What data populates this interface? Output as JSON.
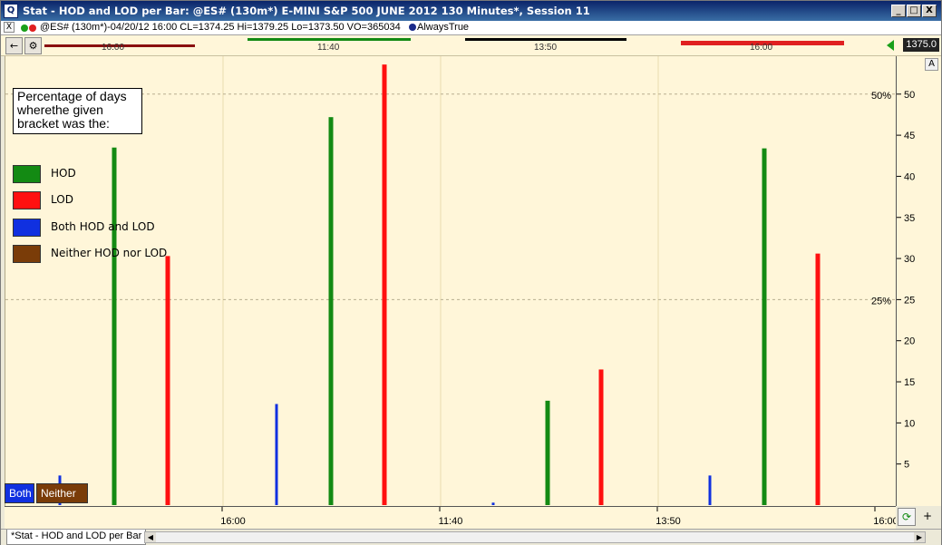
{
  "window": {
    "title": "Stat - HOD and LOD per Bar: @ES# (130m*) E-MINI S&P 500 JUNE 2012 130 Minutes*, Session 11",
    "minimize": "_",
    "maximize": "□",
    "close": "X"
  },
  "status": {
    "close_x": "X",
    "info": "@ES# (130m*)-04/20/12 16:00 CL=1374.25 Hi=1379.25 Lo=1373.50 VO=365034",
    "indicator": "AlwaysTrue",
    "indicator_color": "#1a2a8a",
    "dot_colors": [
      "#1aa01a",
      "#e02020"
    ]
  },
  "toprow": {
    "ticks": [
      "16:00",
      "11:40",
      "13:50",
      "16:00"
    ],
    "price": "1375.0",
    "price_top": "1375"
  },
  "legend": {
    "note": "Percentage of days wherethe given bracket was the:",
    "items": [
      {
        "label": "HOD",
        "color": "#138a13"
      },
      {
        "label": "LOD",
        "color": "#ff1010"
      },
      {
        "label": "Both HOD and LOD",
        "color": "#1030e0"
      },
      {
        "label": "Neither HOD nor LOD",
        "color": "#7a3c08"
      }
    ]
  },
  "buttons": {
    "both": "Both",
    "neither": "Neither",
    "axis_auto": "A",
    "refresh": "⟳",
    "add": "+"
  },
  "chart_data": {
    "type": "bar",
    "x_ticks": [
      "16:00",
      "11:40",
      "13:50",
      "16:00"
    ],
    "y_ticks": [
      5,
      10,
      15,
      20,
      25,
      30,
      35,
      40,
      45,
      50
    ],
    "ylim": [
      0,
      54.5
    ],
    "reference_lines": [
      {
        "value": 50,
        "label": "50%"
      },
      {
        "value": 25,
        "label": "25%"
      }
    ],
    "groups": [
      {
        "both": 3.6,
        "hod": 43.5,
        "lod": 30.3
      },
      {
        "both": 12.3,
        "hod": 47.2,
        "lod": 53.6
      },
      {
        "both": 0.3,
        "hod": 12.7,
        "lod": 16.5
      },
      {
        "both": 3.6,
        "hod": 43.4,
        "lod": 30.6
      }
    ]
  },
  "tabs": {
    "active": "*Stat - HOD and LOD per Bar"
  }
}
